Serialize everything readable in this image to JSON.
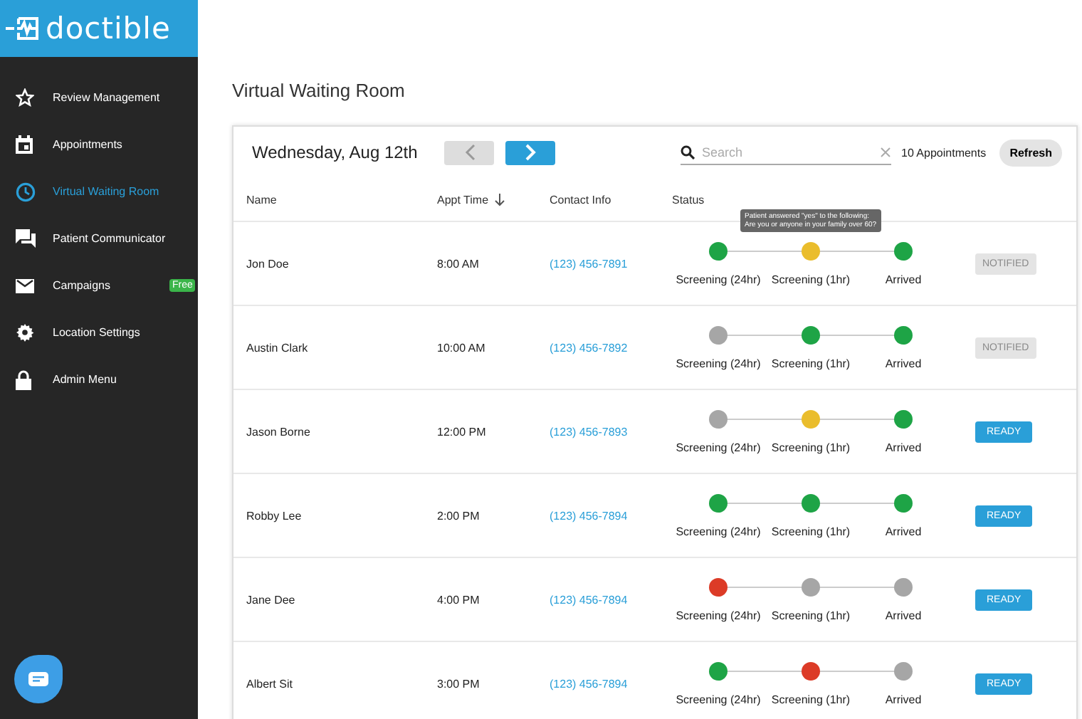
{
  "logo": {
    "text": "doctible"
  },
  "sidebar": {
    "items": [
      {
        "label": "Review Management",
        "kind": "star",
        "selected": false
      },
      {
        "label": "Appointments",
        "kind": "calendar",
        "selected": false
      },
      {
        "label": "Virtual Waiting Room",
        "kind": "clock",
        "selected": true
      },
      {
        "label": "Patient Communicator",
        "kind": "chat",
        "selected": false
      },
      {
        "label": "Campaigns",
        "kind": "mail",
        "selected": false,
        "badge": "Free"
      },
      {
        "label": "Location Settings",
        "kind": "gear",
        "selected": false
      },
      {
        "label": "Admin Menu",
        "kind": "lock",
        "selected": false
      }
    ]
  },
  "page_title": "Virtual Waiting Room",
  "toolbar": {
    "date": "Wednesday, Aug 12th",
    "prev_disabled": true,
    "search": {
      "placeholder": "Search"
    },
    "count": "10 Appointments",
    "refresh": "Refresh"
  },
  "table": {
    "columns": [
      "Name",
      "Appt Time",
      "Contact Info",
      "Status"
    ],
    "tooltip": {
      "lines": [
        "Patient answered \"yes\" to the following:",
        "Are you or anyone in your family over 60?"
      ]
    },
    "rows": [
      {
        "name": "Jon Doe",
        "time": "8:00 AM",
        "contact": "(123) 456-7891",
        "steps": [
          {
            "label": "Screening (24hr)",
            "color": "#1ea446"
          },
          {
            "label": "Screening (1hr)",
            "color": "#eabd2c"
          },
          {
            "label": "Arrived",
            "color": "#1ea446"
          }
        ],
        "action": {
          "kind": "notified",
          "label": "NOTIFIED"
        }
      },
      {
        "name": "Austin Clark",
        "time": "10:00 AM",
        "contact": "(123) 456-7892",
        "steps": [
          {
            "label": "Screening (24hr)",
            "color": "#a6a6a6"
          },
          {
            "label": "Screening (1hr)",
            "color": "#1ea446"
          },
          {
            "label": "Arrived",
            "color": "#1ea446"
          }
        ],
        "action": {
          "kind": "notified",
          "label": "NOTIFIED"
        }
      },
      {
        "name": "Jason Borne",
        "time": "12:00 PM",
        "contact": "(123) 456-7893",
        "steps": [
          {
            "label": "Screening (24hr)",
            "color": "#a6a6a6"
          },
          {
            "label": "Screening (1hr)",
            "color": "#eabd2c"
          },
          {
            "label": "Arrived",
            "color": "#1ea446"
          }
        ],
        "action": {
          "kind": "ready",
          "label": "READY"
        }
      },
      {
        "name": "Robby Lee",
        "time": "2:00 PM",
        "contact": "(123) 456-7894",
        "steps": [
          {
            "label": "Screening (24hr)",
            "color": "#1ea446"
          },
          {
            "label": "Screening (1hr)",
            "color": "#1ea446"
          },
          {
            "label": "Arrived",
            "color": "#1ea446"
          }
        ],
        "action": {
          "kind": "ready",
          "label": "READY"
        }
      },
      {
        "name": "Jane Dee",
        "time": "4:00 PM",
        "contact": "(123) 456-7894",
        "steps": [
          {
            "label": "Screening (24hr)",
            "color": "#dc3b27"
          },
          {
            "label": "Screening (1hr)",
            "color": "#a6a6a6"
          },
          {
            "label": "Arrived",
            "color": "#a6a6a6"
          }
        ],
        "action": {
          "kind": "ready",
          "label": "READY"
        }
      },
      {
        "name": "Albert Sit",
        "time": "3:00 PM",
        "contact": "(123) 456-7894",
        "steps": [
          {
            "label": "Screening (24hr)",
            "color": "#1ea446"
          },
          {
            "label": "Screening (1hr)",
            "color": "#dc3b27"
          },
          {
            "label": "Arrived",
            "color": "#a6a6a6"
          }
        ],
        "action": {
          "kind": "ready",
          "label": "READY"
        }
      }
    ]
  }
}
